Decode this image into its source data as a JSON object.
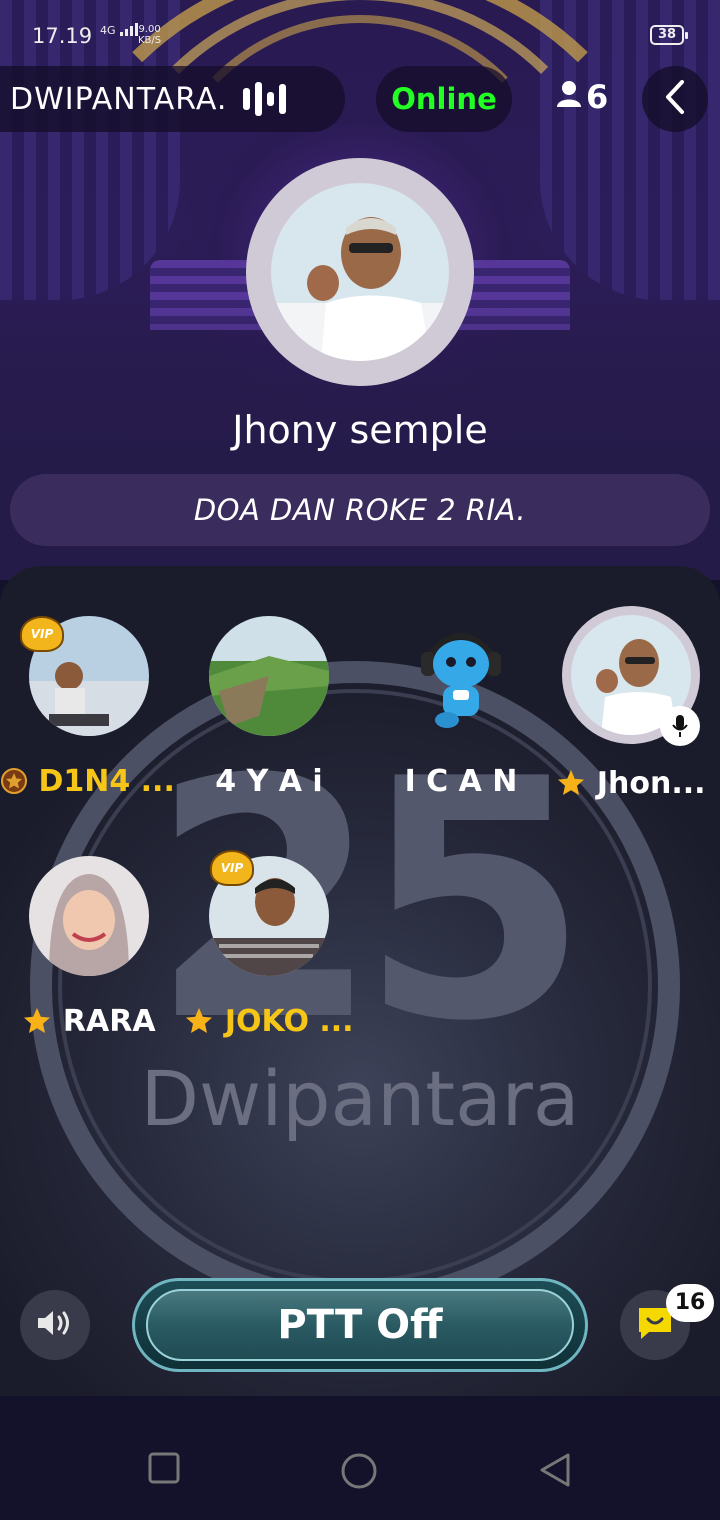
{
  "status_bar": {
    "time": "17.19",
    "network": "4G",
    "speed_value": "9.00",
    "speed_unit": "KB/S",
    "battery": "38"
  },
  "header": {
    "room_title": "DWIPANTARA.",
    "online_label": "Online",
    "member_count": "6"
  },
  "host": {
    "name": "Jhony semple"
  },
  "topic": "DOA DAN ROKE 2 RIA.",
  "background_logo": {
    "number": "25",
    "word": "Dwipantara"
  },
  "seats": [
    {
      "name": "D1N4 ...",
      "badge": "VIP",
      "name_prefix_icon": "medal-icon",
      "name_color": "gold"
    },
    {
      "name": "4 Y A i",
      "name_color": "white"
    },
    {
      "name": "I C A N",
      "name_color": "white"
    },
    {
      "name": "Jhon...",
      "name_prefix_icon": "star-icon",
      "name_color": "white",
      "speaking": true
    },
    {
      "name": "RARA",
      "name_prefix_icon": "star-icon",
      "name_color": "white"
    },
    {
      "name": "JOKO ...",
      "badge": "VIP",
      "name_prefix_icon": "star-icon",
      "name_color": "gold"
    }
  ],
  "controls": {
    "ptt_label": "PTT Off",
    "chat_unread": "16"
  },
  "colors": {
    "online": "#22ff22",
    "gold_name": "#f5c518",
    "ptt_border": "#6fb6c0"
  }
}
